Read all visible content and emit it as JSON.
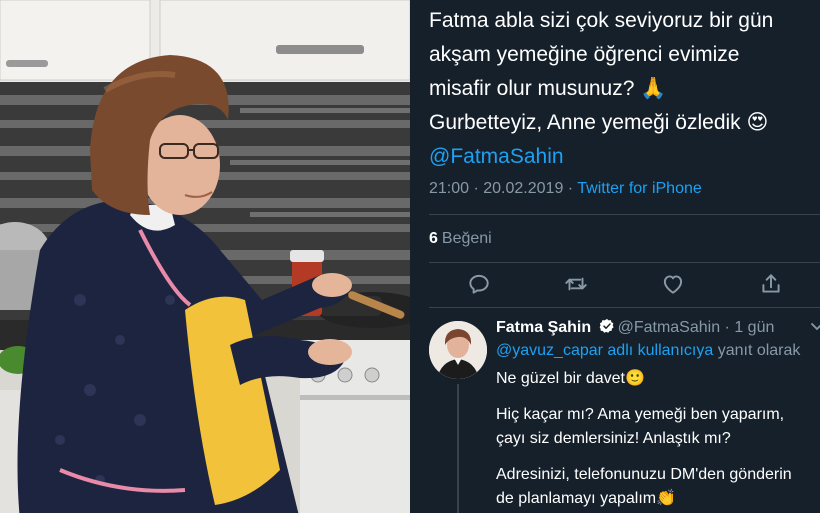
{
  "photo": {
    "subject": "woman-cooking-photo"
  },
  "tweet": {
    "lines": [
      "Fatma abla sizi çok seviyoruz bir gün",
      "akşam yemeğine öğrenci evimize",
      "misafir olur musunuz? 🙏",
      "Gurbetteyiz, Anne yemeği özledik 😍"
    ],
    "mention": "@FatmaSahin",
    "time": "21:00 · 20.02.2019 · ",
    "client": "Twitter for iPhone",
    "likes_count": "6",
    "likes_label": "Beğeni"
  },
  "actions": [
    {
      "name": "reply-icon"
    },
    {
      "name": "retweet-icon"
    },
    {
      "name": "like-icon"
    },
    {
      "name": "share-icon"
    }
  ],
  "reply": {
    "name": "Fatma Şahin",
    "handle": "@FatmaSahin",
    "age": " · 1 gün",
    "replying_mention": "@yavuz_capar adlı kullanıcıya",
    "replying_suffix": " yanıt olarak",
    "body": [
      "Ne güzel bir davet🙂",
      "Hiç kaçar mı? Ama yemeği ben yaparım,",
      "çayı siz demlersiniz! Anlaştık mı?",
      "Adresinizi, telefonunuzu DM'den gönderin",
      "de planlamayı yapalım👏"
    ]
  },
  "colors": {
    "background": "#15202b",
    "accent": "#1da1f2",
    "muted": "#8899a6",
    "divider": "#38444d"
  }
}
